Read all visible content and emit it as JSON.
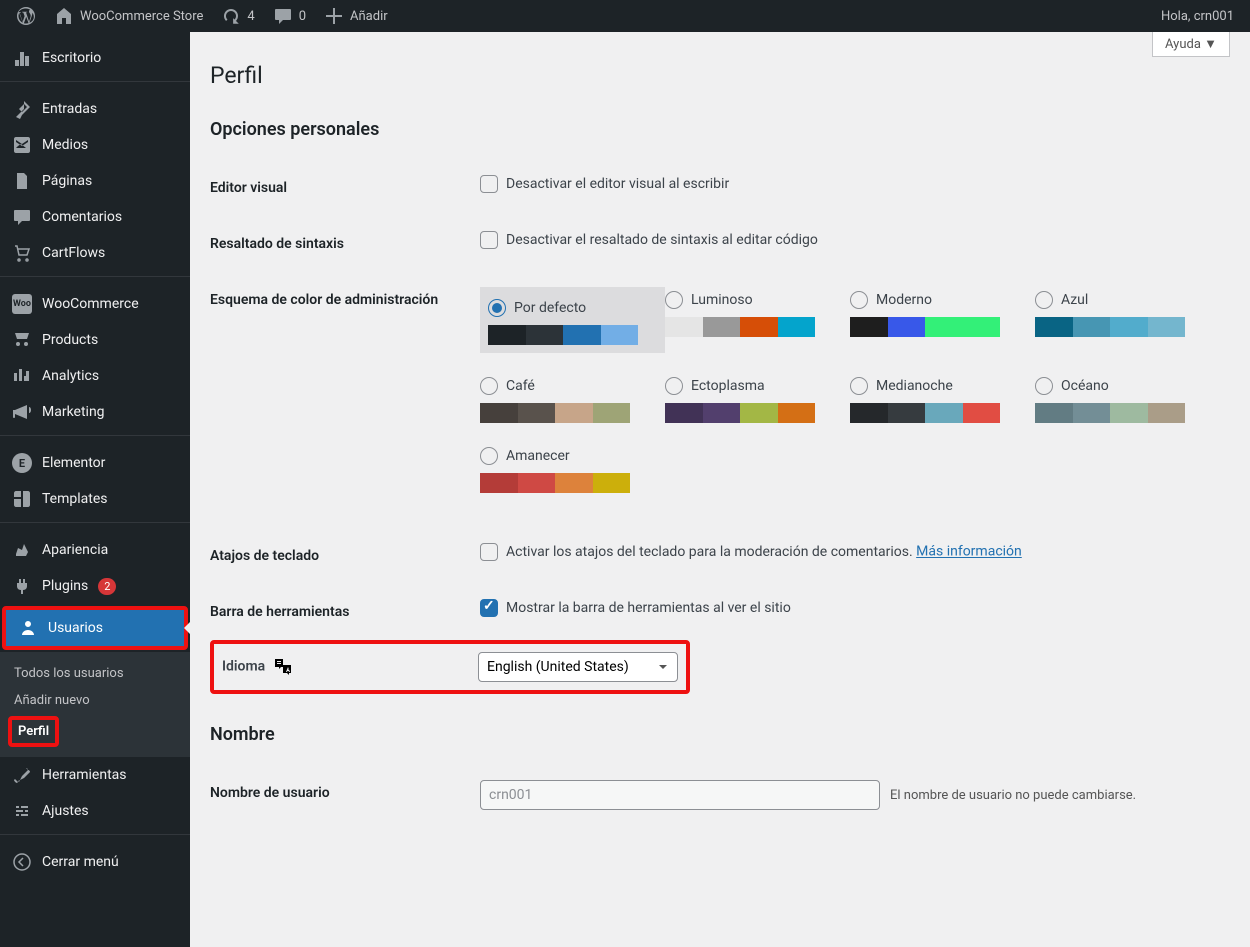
{
  "adminbar": {
    "site_title": "WooCommerce Store",
    "updates": "4",
    "comments": "0",
    "add_new": "Añadir",
    "greeting": "Hola, crn001"
  },
  "help": "Ayuda",
  "sidebar": {
    "dashboard": "Escritorio",
    "posts": "Entradas",
    "media": "Medios",
    "pages": "Páginas",
    "comments": "Comentarios",
    "cartflows": "CartFlows",
    "woocommerce": "WooCommerce",
    "products": "Products",
    "analytics": "Analytics",
    "marketing": "Marketing",
    "elementor": "Elementor",
    "templates": "Templates",
    "appearance": "Apariencia",
    "plugins": "Plugins",
    "plugins_count": "2",
    "users": "Usuarios",
    "tools": "Herramientas",
    "settings": "Ajustes",
    "collapse": "Cerrar menú",
    "submenu": {
      "all_users": "Todos los usuarios",
      "add_new": "Añadir nuevo",
      "profile": "Perfil"
    }
  },
  "page": {
    "title": "Perfil",
    "section_personal": "Opciones personales",
    "visual_editor_label": "Editor visual",
    "visual_editor_text": "Desactivar el editor visual al escribir",
    "syntax_label": "Resaltado de sintaxis",
    "syntax_text": "Desactivar el resaltado de sintaxis al editar código",
    "color_scheme_label": "Esquema de color de administración",
    "schemes": {
      "default": "Por defecto",
      "light": "Luminoso",
      "modern": "Moderno",
      "blue": "Azul",
      "coffee": "Café",
      "ectoplasm": "Ectoplasma",
      "midnight": "Medianoche",
      "ocean": "Océano",
      "sunrise": "Amanecer"
    },
    "shortcuts_label": "Atajos de teclado",
    "shortcuts_text": "Activar los atajos del teclado para la moderación de comentarios. ",
    "shortcuts_link": "Más información",
    "toolbar_label": "Barra de herramientas",
    "toolbar_text": "Mostrar la barra de herramientas al ver el sitio",
    "language_label": "Idioma",
    "language_value": "English (United States)",
    "section_name": "Nombre",
    "username_label": "Nombre de usuario",
    "username_value": "crn001",
    "username_desc": "El nombre de usuario no puede cambiarse."
  },
  "palettes": {
    "default": [
      "#1d2327",
      "#2c3338",
      "#2271b1",
      "#72aee6"
    ],
    "light": [
      "#e5e5e5",
      "#999999",
      "#d64e07",
      "#04a4cc"
    ],
    "modern": [
      "#1e1e1e",
      "#3858e9",
      "#33f078",
      "#33f078"
    ],
    "blue": [
      "#096484",
      "#4796b3",
      "#52accc",
      "#74b6ce"
    ],
    "coffee": [
      "#46403c",
      "#59524c",
      "#c7a589",
      "#9ea476"
    ],
    "ectoplasm": [
      "#413256",
      "#523f6d",
      "#a3b745",
      "#d46f15"
    ],
    "midnight": [
      "#25282b",
      "#363b3f",
      "#69a8bb",
      "#e14d43"
    ],
    "ocean": [
      "#627c83",
      "#738e96",
      "#9ebaa0",
      "#aa9d88"
    ],
    "sunrise": [
      "#b43c38",
      "#cf4944",
      "#dd823b",
      "#ccaf0b"
    ]
  }
}
